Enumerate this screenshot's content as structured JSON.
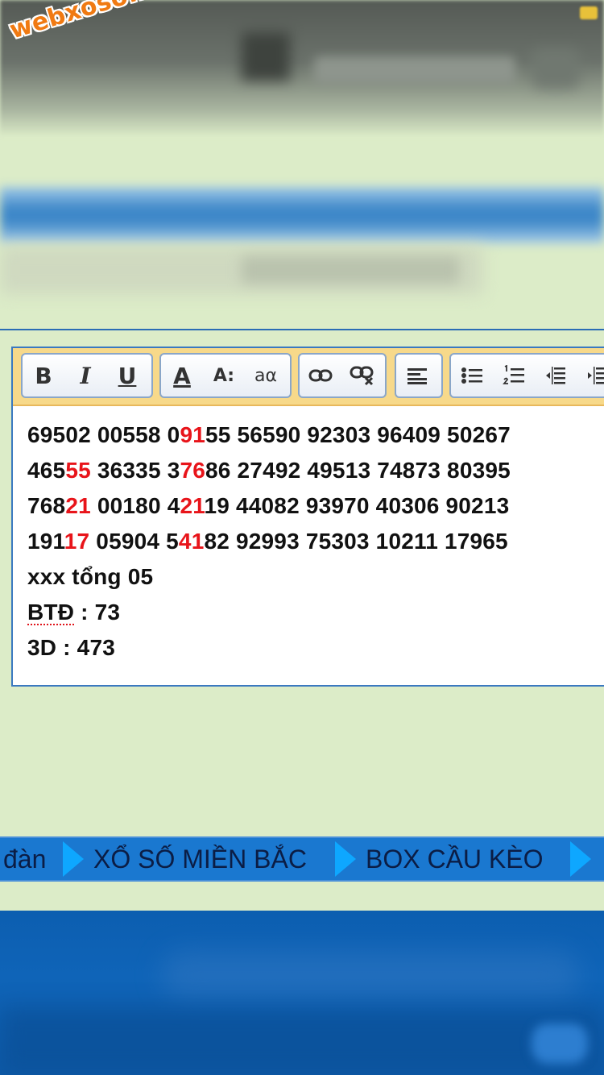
{
  "watermark": {
    "logo_text": "webxoso.net"
  },
  "toolbar": {
    "bold": "B",
    "italic": "I",
    "underline": "U",
    "font_color": "A",
    "font_size": "A:",
    "font_family": "aα"
  },
  "editor": {
    "lines": [
      [
        {
          "t": "69502 00558 0"
        },
        {
          "t": "91",
          "r": true
        },
        {
          "t": "55 56590 92303 96409 50267"
        }
      ],
      [
        {
          "t": "465"
        },
        {
          "t": "55",
          "r": true
        },
        {
          "t": " 36335 3"
        },
        {
          "t": "76",
          "r": true
        },
        {
          "t": "86 27492 49513 74873 80395"
        }
      ],
      [
        {
          "t": "768"
        },
        {
          "t": "21",
          "r": true
        },
        {
          "t": " 00180 4"
        },
        {
          "t": "21",
          "r": true
        },
        {
          "t": "19 44082 93970 40306 90213"
        }
      ],
      [
        {
          "t": "191"
        },
        {
          "t": "17",
          "r": true
        },
        {
          "t": " 05904 5"
        },
        {
          "t": "41",
          "r": true
        },
        {
          "t": "82 92993 75303 10211 17965"
        }
      ]
    ],
    "sum_line": "xxx tổng 05",
    "btd_label": "BTĐ",
    "btd_value": " : 73",
    "three_d": "3D : 473"
  },
  "nav": {
    "items": [
      "đàn",
      "XỔ SỐ MIỀN BẮC",
      "BOX CẦU KÈO"
    ]
  },
  "colors": {
    "highlight": "#e8141a",
    "nav_bg": "#1a78d0",
    "chevron": "#0ea7ff"
  }
}
